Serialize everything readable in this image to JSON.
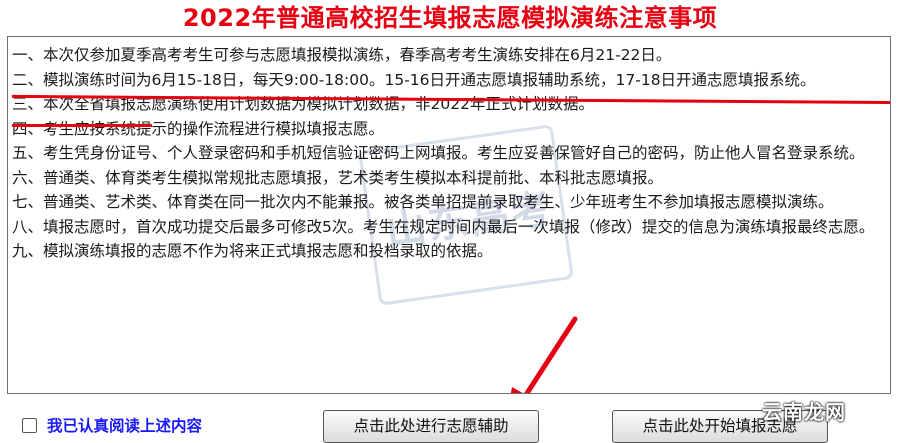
{
  "title": "2022年普通高校招生填报志愿模拟演练注意事项",
  "notices": [
    "一、本次仅参加夏季高考考生可参与志愿填报模拟演练，春季高考考生演练安排在6月21-22日。",
    "二、模拟演练时间为6月15-18日，每天9:00-18:00。15-16日开通志愿填报辅助系统，17-18日开通志愿填报系统。",
    "三、本次全省填报志愿演练使用计划数据为模拟计划数据，非2022年正式计划数据。",
    "四、考生应按系统提示的操作流程进行模拟填报志愿。",
    "五、考生凭身份证号、个人登录密码和手机短信验证密码上网填报。考生应妥善保管好自己的密码，防止他人冒名登录系统。",
    "六、普通类、体育类考生模拟常规批志愿填报，艺术类考生模拟本科提前批、本科批志愿填报。",
    "七、普通类、艺术类、体育类在同一批次内不能兼报。被各类单招提前录取考生、少年班考生不参加填报志愿模拟演练。",
    "八、填报志愿时，首次成功提交后最多可修改5次。考生在规定时间内最后一次填报（修改）提交的信息为演练填报最终志愿。",
    "九、模拟演练填报的志愿不作为将来正式填报志愿和投档录取的依据。"
  ],
  "agree_label": "我已认真阅读上述内容",
  "buttons": {
    "assist": "点击此处进行志愿辅助",
    "start": "点击此处开始填报志愿"
  },
  "watermark_text": "山东高考",
  "corner_watermark": "云南龙网",
  "colors": {
    "title": "#e60012",
    "agree": "#1a1aff",
    "annotation": "#e60012"
  }
}
